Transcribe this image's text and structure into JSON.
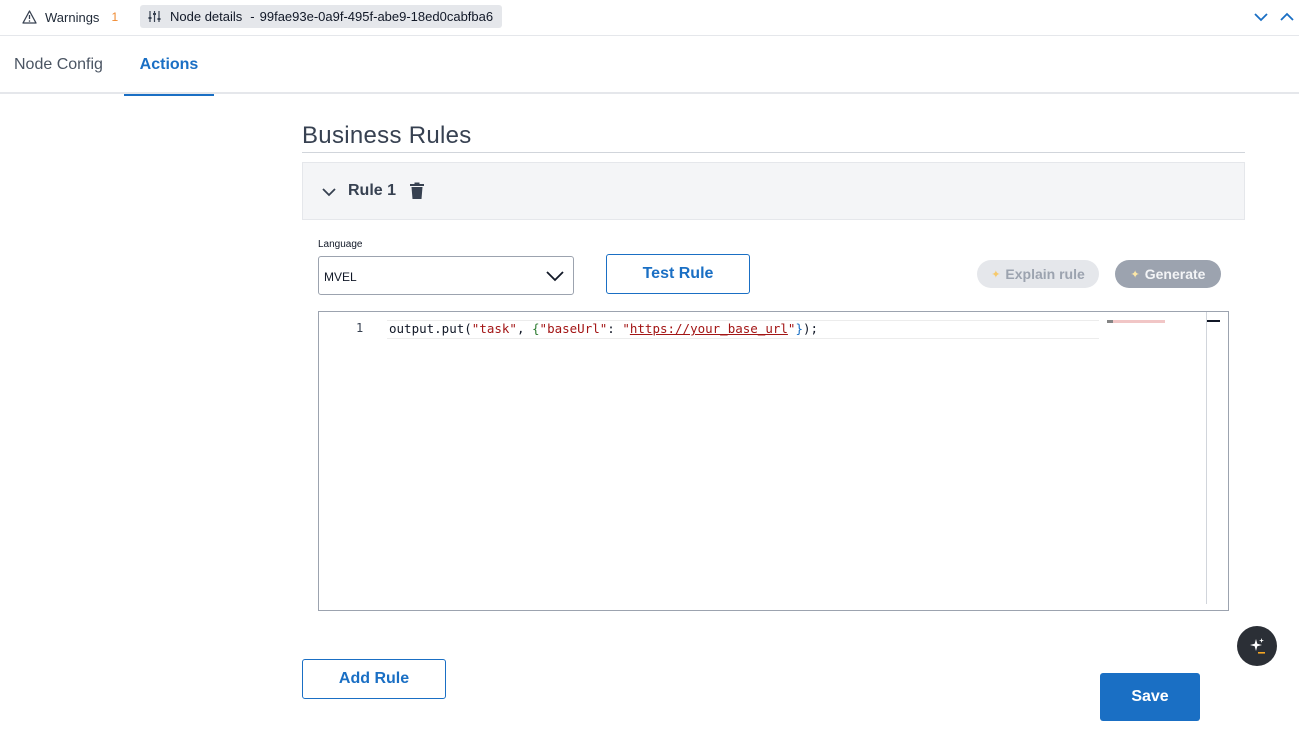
{
  "topbar": {
    "warnings_label": "Warnings",
    "warnings_count": "1",
    "node_details_label": "Node details",
    "node_separator": "-",
    "node_id": "99fae93e-0a9f-495f-abe9-18ed0cabfba6"
  },
  "tabs": [
    {
      "label": "Node Config",
      "active": false
    },
    {
      "label": "Actions",
      "active": true
    }
  ],
  "section": {
    "title": "Business Rules"
  },
  "rule": {
    "title": "Rule 1"
  },
  "language": {
    "label": "Language",
    "selected": "MVEL"
  },
  "buttons": {
    "test_rule": "Test Rule",
    "explain_rule": "Explain rule",
    "generate": "Generate",
    "add_rule": "Add Rule",
    "save": "Save"
  },
  "editor": {
    "line_number": "1",
    "code_prefix": "output.put(",
    "code_str1": "\"task\"",
    "code_mid": ", ",
    "code_brace_open": "{",
    "code_str2": "\"baseUrl\"",
    "code_colon": ": ",
    "code_q1": "\"",
    "code_url": "https://your_base_url",
    "code_q2": "\"",
    "code_brace_close": "}",
    "code_suffix": ");"
  },
  "colors": {
    "accent": "#1a6fc4",
    "warning": "#f0892f"
  },
  "icons": {
    "warning": "warning-triangle-icon",
    "sliders": "sliders-icon",
    "chevron_down": "chevron-down-icon",
    "chevron_up": "chevron-up-icon",
    "trash": "trash-icon",
    "sparkle": "sparkle-icon"
  }
}
